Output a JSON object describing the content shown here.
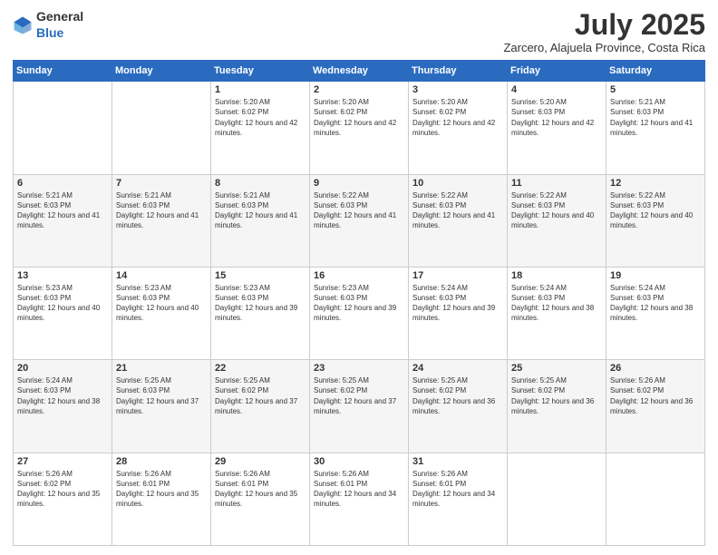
{
  "header": {
    "logo_general": "General",
    "logo_blue": "Blue",
    "month": "July 2025",
    "location": "Zarcero, Alajuela Province, Costa Rica"
  },
  "weekdays": [
    "Sunday",
    "Monday",
    "Tuesday",
    "Wednesday",
    "Thursday",
    "Friday",
    "Saturday"
  ],
  "weeks": [
    [
      {
        "day": "",
        "info": ""
      },
      {
        "day": "",
        "info": ""
      },
      {
        "day": "1",
        "info": "Sunrise: 5:20 AM\nSunset: 6:02 PM\nDaylight: 12 hours and 42 minutes."
      },
      {
        "day": "2",
        "info": "Sunrise: 5:20 AM\nSunset: 6:02 PM\nDaylight: 12 hours and 42 minutes."
      },
      {
        "day": "3",
        "info": "Sunrise: 5:20 AM\nSunset: 6:02 PM\nDaylight: 12 hours and 42 minutes."
      },
      {
        "day": "4",
        "info": "Sunrise: 5:20 AM\nSunset: 6:03 PM\nDaylight: 12 hours and 42 minutes."
      },
      {
        "day": "5",
        "info": "Sunrise: 5:21 AM\nSunset: 6:03 PM\nDaylight: 12 hours and 41 minutes."
      }
    ],
    [
      {
        "day": "6",
        "info": "Sunrise: 5:21 AM\nSunset: 6:03 PM\nDaylight: 12 hours and 41 minutes."
      },
      {
        "day": "7",
        "info": "Sunrise: 5:21 AM\nSunset: 6:03 PM\nDaylight: 12 hours and 41 minutes."
      },
      {
        "day": "8",
        "info": "Sunrise: 5:21 AM\nSunset: 6:03 PM\nDaylight: 12 hours and 41 minutes."
      },
      {
        "day": "9",
        "info": "Sunrise: 5:22 AM\nSunset: 6:03 PM\nDaylight: 12 hours and 41 minutes."
      },
      {
        "day": "10",
        "info": "Sunrise: 5:22 AM\nSunset: 6:03 PM\nDaylight: 12 hours and 41 minutes."
      },
      {
        "day": "11",
        "info": "Sunrise: 5:22 AM\nSunset: 6:03 PM\nDaylight: 12 hours and 40 minutes."
      },
      {
        "day": "12",
        "info": "Sunrise: 5:22 AM\nSunset: 6:03 PM\nDaylight: 12 hours and 40 minutes."
      }
    ],
    [
      {
        "day": "13",
        "info": "Sunrise: 5:23 AM\nSunset: 6:03 PM\nDaylight: 12 hours and 40 minutes."
      },
      {
        "day": "14",
        "info": "Sunrise: 5:23 AM\nSunset: 6:03 PM\nDaylight: 12 hours and 40 minutes."
      },
      {
        "day": "15",
        "info": "Sunrise: 5:23 AM\nSunset: 6:03 PM\nDaylight: 12 hours and 39 minutes."
      },
      {
        "day": "16",
        "info": "Sunrise: 5:23 AM\nSunset: 6:03 PM\nDaylight: 12 hours and 39 minutes."
      },
      {
        "day": "17",
        "info": "Sunrise: 5:24 AM\nSunset: 6:03 PM\nDaylight: 12 hours and 39 minutes."
      },
      {
        "day": "18",
        "info": "Sunrise: 5:24 AM\nSunset: 6:03 PM\nDaylight: 12 hours and 38 minutes."
      },
      {
        "day": "19",
        "info": "Sunrise: 5:24 AM\nSunset: 6:03 PM\nDaylight: 12 hours and 38 minutes."
      }
    ],
    [
      {
        "day": "20",
        "info": "Sunrise: 5:24 AM\nSunset: 6:03 PM\nDaylight: 12 hours and 38 minutes."
      },
      {
        "day": "21",
        "info": "Sunrise: 5:25 AM\nSunset: 6:03 PM\nDaylight: 12 hours and 37 minutes."
      },
      {
        "day": "22",
        "info": "Sunrise: 5:25 AM\nSunset: 6:02 PM\nDaylight: 12 hours and 37 minutes."
      },
      {
        "day": "23",
        "info": "Sunrise: 5:25 AM\nSunset: 6:02 PM\nDaylight: 12 hours and 37 minutes."
      },
      {
        "day": "24",
        "info": "Sunrise: 5:25 AM\nSunset: 6:02 PM\nDaylight: 12 hours and 36 minutes."
      },
      {
        "day": "25",
        "info": "Sunrise: 5:25 AM\nSunset: 6:02 PM\nDaylight: 12 hours and 36 minutes."
      },
      {
        "day": "26",
        "info": "Sunrise: 5:26 AM\nSunset: 6:02 PM\nDaylight: 12 hours and 36 minutes."
      }
    ],
    [
      {
        "day": "27",
        "info": "Sunrise: 5:26 AM\nSunset: 6:02 PM\nDaylight: 12 hours and 35 minutes."
      },
      {
        "day": "28",
        "info": "Sunrise: 5:26 AM\nSunset: 6:01 PM\nDaylight: 12 hours and 35 minutes."
      },
      {
        "day": "29",
        "info": "Sunrise: 5:26 AM\nSunset: 6:01 PM\nDaylight: 12 hours and 35 minutes."
      },
      {
        "day": "30",
        "info": "Sunrise: 5:26 AM\nSunset: 6:01 PM\nDaylight: 12 hours and 34 minutes."
      },
      {
        "day": "31",
        "info": "Sunrise: 5:26 AM\nSunset: 6:01 PM\nDaylight: 12 hours and 34 minutes."
      },
      {
        "day": "",
        "info": ""
      },
      {
        "day": "",
        "info": ""
      }
    ]
  ]
}
